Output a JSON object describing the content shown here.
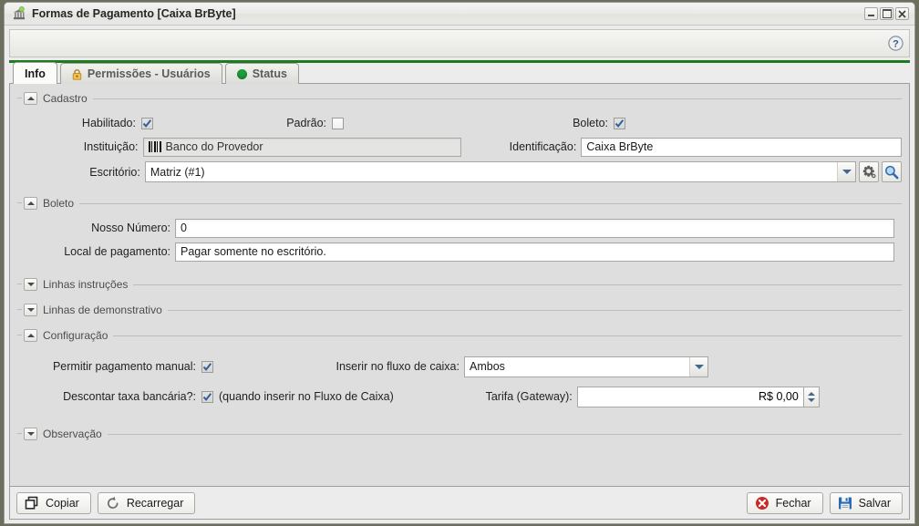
{
  "window": {
    "title": "Formas de Pagamento [Caixa BrByte]",
    "icon": "bank-icon",
    "controls": {
      "minimize": "–",
      "maximize": "□",
      "close": "✕"
    }
  },
  "toolbar": {
    "help_icon": "help-icon"
  },
  "tabs": [
    {
      "label": "Info",
      "icon": null,
      "active": true
    },
    {
      "label": "Permissões - Usuários",
      "icon": "lock-icon",
      "active": false
    },
    {
      "label": "Status",
      "icon": "green-dot-icon",
      "active": false
    }
  ],
  "sections": {
    "cadastro": {
      "title": "Cadastro",
      "expanded": true,
      "habilitado_label": "Habilitado:",
      "habilitado_checked": true,
      "padrao_label": "Padrão:",
      "padrao_checked": false,
      "boleto_label": "Boleto:",
      "boleto_checked": true,
      "instituicao_label": "Instituição:",
      "instituicao_value": "Banco do Provedor",
      "identificacao_label": "Identificação:",
      "identificacao_value": "Caixa BrByte",
      "escritorio_label": "Escritório:",
      "escritorio_value": "Matriz (#1)"
    },
    "boleto": {
      "title": "Boleto",
      "expanded": true,
      "nosso_numero_label": "Nosso Número:",
      "nosso_numero_value": "0",
      "local_pagamento_label": "Local de pagamento:",
      "local_pagamento_value": "Pagar somente no escritório."
    },
    "linhas_instrucoes": {
      "title": "Linhas instruções",
      "expanded": false
    },
    "linhas_demonstrativo": {
      "title": "Linhas de demonstrativo",
      "expanded": false
    },
    "configuracao": {
      "title": "Configuração",
      "expanded": true,
      "permitir_label": "Permitir pagamento manual:",
      "permitir_checked": true,
      "descontar_label": "Descontar taxa bancária?:",
      "descontar_checked": true,
      "descontar_note": "(quando inserir no Fluxo de Caixa)",
      "inserir_fluxo_label": "Inserir no fluxo de caixa:",
      "inserir_fluxo_value": "Ambos",
      "tarifa_label": "Tarifa (Gateway):",
      "tarifa_value": "R$ 0,00"
    },
    "observacao": {
      "title": "Observação",
      "expanded": false
    }
  },
  "footer": {
    "copiar_label": "Copiar",
    "recarregar_label": "Recarregar",
    "fechar_label": "Fechar",
    "salvar_label": "Salvar"
  },
  "colors": {
    "accent_green": "#1f7a1f",
    "panel_bg": "#dedede",
    "close_red": "#cc2a2a",
    "save_blue": "#2a6bb5",
    "lock_yellow": "#f2c14b"
  }
}
